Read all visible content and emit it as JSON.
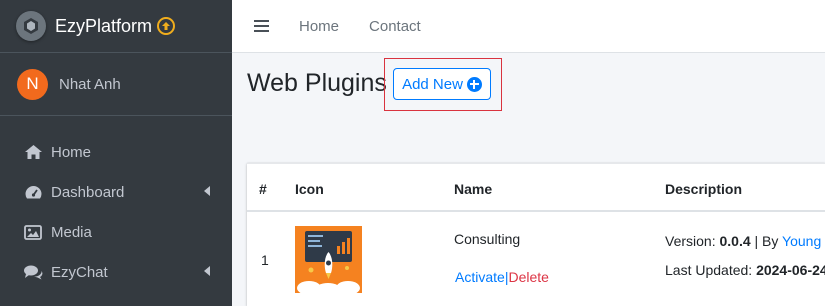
{
  "app": {
    "brand": "EzyPlatform"
  },
  "user": {
    "initial": "N",
    "name": "Nhat Anh"
  },
  "sidebar": {
    "items": [
      {
        "label": "Home",
        "icon": "home-icon",
        "has_submenu": false
      },
      {
        "label": "Dashboard",
        "icon": "dashboard-icon",
        "has_submenu": true
      },
      {
        "label": "Media",
        "icon": "image-icon",
        "has_submenu": false
      },
      {
        "label": "EzyChat",
        "icon": "chat-icon",
        "has_submenu": true
      }
    ]
  },
  "topbar": {
    "links": [
      "Home",
      "Contact"
    ]
  },
  "main": {
    "title": "Web Plugins",
    "add_button": "Add New"
  },
  "table": {
    "headers": [
      "#",
      "Icon",
      "Name",
      "Description"
    ],
    "rows": [
      {
        "index": "1",
        "name": "Consulting",
        "activate": "Activate",
        "separator": "|",
        "delete": "Delete",
        "version_label": "Version:",
        "version": "0.0.4",
        "by_label": "| By",
        "author": "Young M",
        "updated_label": "Last Updated:",
        "updated": "2024-06-24"
      }
    ]
  },
  "colors": {
    "sidebar_bg": "#343a40",
    "primary": "#007bff",
    "danger": "#dc3545",
    "avatar": "#f26a1d",
    "highlight": "#d9333f"
  }
}
